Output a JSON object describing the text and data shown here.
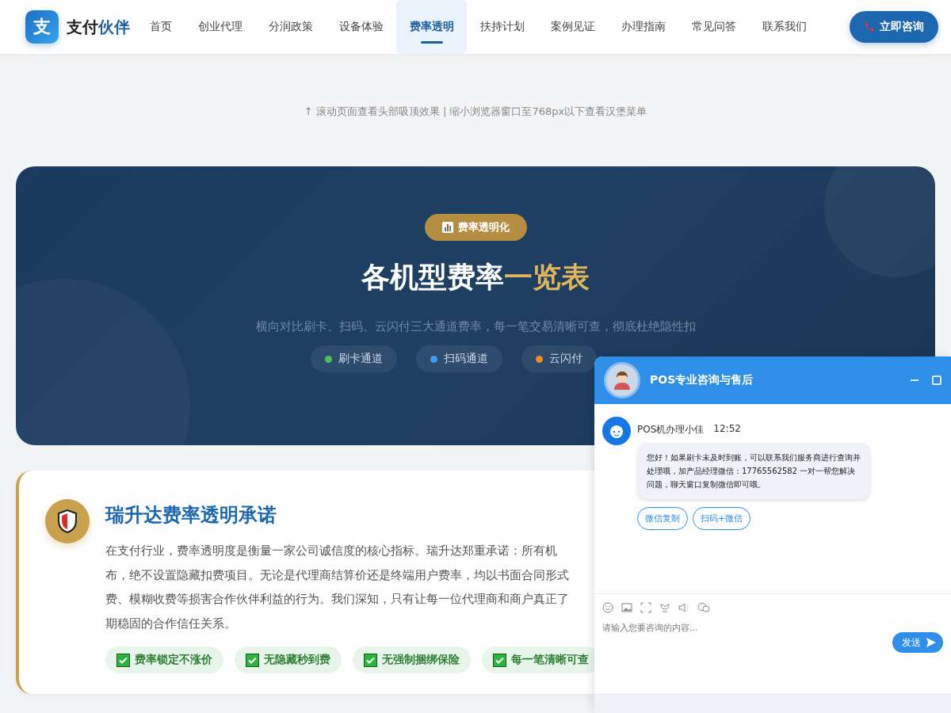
{
  "nav": {
    "logo_mark": "支",
    "brand": "支付",
    "brand_highlight": "伙伴",
    "items": [
      {
        "label": "首页",
        "selected": false
      },
      {
        "label": "创业代理",
        "selected": false
      },
      {
        "label": "分润政策",
        "selected": false
      },
      {
        "label": "设备体验",
        "selected": false
      },
      {
        "label": "费率透明",
        "selected": true
      },
      {
        "label": "扶持计划",
        "selected": false
      },
      {
        "label": "案例见证",
        "selected": false
      },
      {
        "label": "办理指南",
        "selected": false
      },
      {
        "label": "常见问答",
        "selected": false
      },
      {
        "label": "联系我们",
        "selected": false
      }
    ],
    "cta": "立即咨询"
  },
  "hint": "↑ 滚动页面查看头部吸顶效果 | 缩小浏览器窗口至768px以下查看汉堡菜单",
  "hero": {
    "badge": "费率透明化",
    "title": "各机型费率",
    "title_highlight": "一览表",
    "subtitle": "横向对比刷卡、扫码、云闪付三大通道费率，每一笔交易清晰可查，彻底杜绝隐性扣",
    "channels": [
      {
        "label": "刷卡通道",
        "color": "#4cc15a"
      },
      {
        "label": "扫码通道",
        "color": "#3b9ef0"
      },
      {
        "label": "云闪付",
        "color": "#f08c1a"
      }
    ]
  },
  "promise": {
    "title": "瑞升达费率透明承诺",
    "lines": [
      "在支付行业，费率透明度是衡量一家公司诚信度的核心指标。瑞升达郑重承诺：所有机",
      "布，绝不设置隐藏扣费项目。无论是代理商结算价还是终端用户费率，均以书面合同形式",
      "费、模糊收费等损害合作伙伴利益的行为。我们深知，只有让每一位代理商和商户真正了",
      "期稳固的合作信任关系。"
    ],
    "tags": [
      "费率锁定不涨价",
      "无隐藏秒到费",
      "无强制捆绑保险",
      "每一笔清晰可查"
    ]
  },
  "chat": {
    "title": "POS专业咨询与售后",
    "sender": "POS机办理小佳",
    "time": "12:52",
    "message": "您好！如果刷卡未及时到账，可以联系我们服务商进行查询并处理哦，加产品经理微信：17765562582 一对一帮您解决问题，聊天窗口复制微信即可哦。",
    "quick_replies": [
      "微信复制",
      "扫码+微信"
    ],
    "placeholder": "请输入您要咨询的内容...",
    "send": "发送"
  }
}
